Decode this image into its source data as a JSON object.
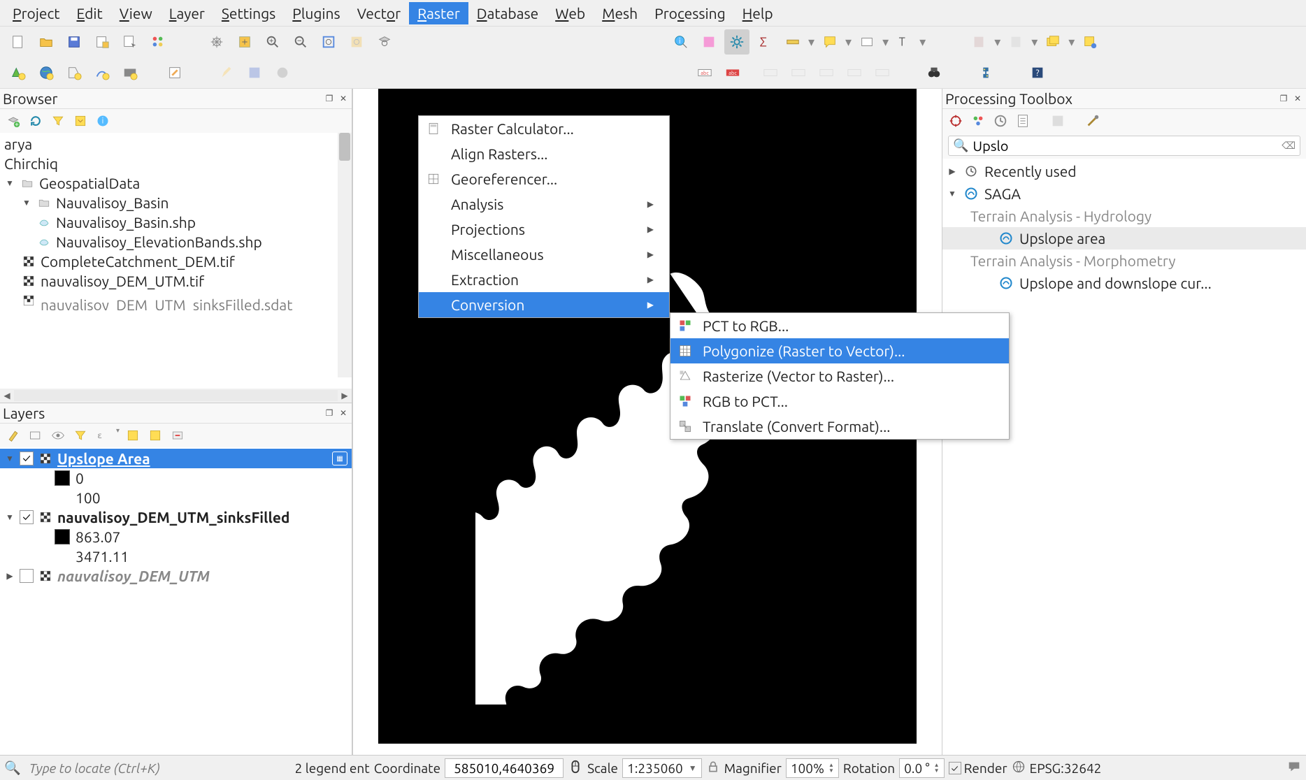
{
  "menu": {
    "items": [
      "Project",
      "Edit",
      "View",
      "Layer",
      "Settings",
      "Plugins",
      "Vector",
      "Raster",
      "Database",
      "Web",
      "Mesh",
      "Processing",
      "Help"
    ],
    "active": "Raster"
  },
  "raster_menu": {
    "items": [
      {
        "label": "Raster Calculator...",
        "icon": "calc"
      },
      {
        "label": "Align Rasters..."
      },
      {
        "label": "Georeferencer...",
        "icon": "grid"
      },
      {
        "label": "Analysis",
        "sub": true
      },
      {
        "label": "Projections",
        "sub": true
      },
      {
        "label": "Miscellaneous",
        "sub": true
      },
      {
        "label": "Extraction",
        "sub": true
      },
      {
        "label": "Conversion",
        "sub": true,
        "active": true
      }
    ],
    "conversion": [
      {
        "label": "PCT to RGB...",
        "icon": "pct"
      },
      {
        "label": "Polygonize (Raster to Vector)...",
        "icon": "poly",
        "active": true
      },
      {
        "label": "Rasterize (Vector to Raster)...",
        "icon": "rast"
      },
      {
        "label": "RGB to PCT...",
        "icon": "rgb"
      },
      {
        "label": "Translate (Convert Format)...",
        "icon": "trans"
      }
    ]
  },
  "browser": {
    "title": "Browser",
    "items": [
      {
        "label": "arya",
        "indent": 0
      },
      {
        "label": "Chirchiq",
        "indent": 0
      },
      {
        "label": "GeospatialData",
        "indent": 0,
        "icon": "folder",
        "expand": "▼"
      },
      {
        "label": "Nauvalisoy_Basin",
        "indent": 1,
        "icon": "folder",
        "expand": "▼"
      },
      {
        "label": "Nauvalisoy_Basin.shp",
        "indent": 2,
        "icon": "poly"
      },
      {
        "label": "Nauvalisoy_ElevationBands.shp",
        "indent": 2,
        "icon": "poly"
      },
      {
        "label": "CompleteCatchment_DEM.tif",
        "indent": 1,
        "icon": "raster"
      },
      {
        "label": "nauvalisoy_DEM_UTM.tif",
        "indent": 1,
        "icon": "raster"
      },
      {
        "label": "nauvalisoy_DEM_UTM_sinksFilled.sdat",
        "indent": 1,
        "icon": "raster"
      }
    ]
  },
  "layers": {
    "title": "Layers",
    "items": [
      {
        "name": "Upslope Area",
        "checked": true,
        "selected": true,
        "icon": "raster",
        "legend": [
          {
            "c": "#000",
            "label": "0"
          },
          {
            "c": "",
            "label": "100"
          }
        ]
      },
      {
        "name": "nauvalisoy_DEM_UTM_sinksFilled",
        "checked": true,
        "icon": "raster",
        "legend": [
          {
            "c": "#000",
            "label": "863.07"
          },
          {
            "c": "",
            "label": "3471.11"
          }
        ],
        "bold": true
      },
      {
        "name": "nauvalisoy_DEM_UTM",
        "checked": false,
        "icon": "raster",
        "dim": true,
        "collapsed": true
      }
    ]
  },
  "processing": {
    "title": "Processing Toolbox",
    "search": "Upslo",
    "tree": [
      {
        "label": "Recently used",
        "icon": "clock",
        "expand": "▶"
      },
      {
        "label": "SAGA",
        "icon": "saga",
        "expand": "▼"
      },
      {
        "label": "Terrain Analysis - Hydrology",
        "sub": true,
        "dim": true
      },
      {
        "label": "Upslope area",
        "subsub": true,
        "icon": "saga",
        "sel": true
      },
      {
        "label": "Terrain Analysis - Morphometry",
        "sub": true,
        "dim": true
      },
      {
        "label": "Upslope and downslope cur...",
        "subsub": true,
        "icon": "saga"
      }
    ]
  },
  "status": {
    "locator_placeholder": "Type to locate (Ctrl+K)",
    "legend": "2 legend ent",
    "coord_label": "Coordinate",
    "coord": "585010,4640369",
    "scale_label": "Scale",
    "scale": "1:235060",
    "mag_label": "Magnifier",
    "mag": "100%",
    "rot_label": "Rotation",
    "rot": "0.0 °",
    "render": "Render",
    "crs": "EPSG:32642"
  }
}
